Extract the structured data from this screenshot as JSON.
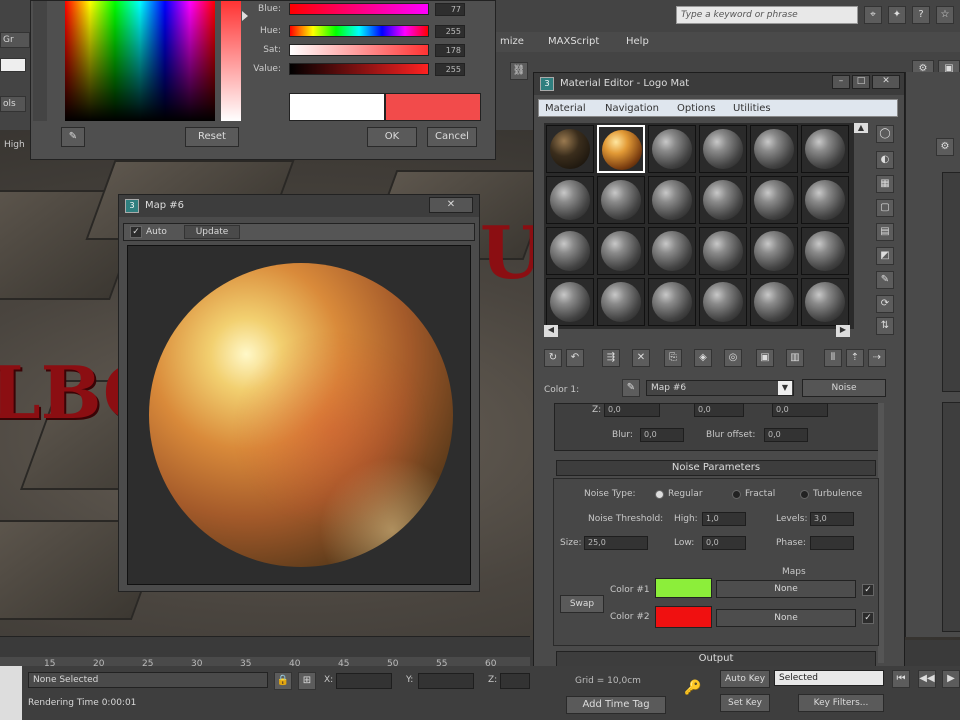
{
  "app": {
    "search_placeholder": "Type a keyword or phrase",
    "menu": [
      "mize",
      "MAXScript",
      "Help"
    ],
    "partial_left": [
      "Gr",
      "ols",
      "High"
    ]
  },
  "color_picker": {
    "sliders": [
      {
        "label": "Blue:",
        "value": "77"
      },
      {
        "label": "Hue:",
        "value": "255"
      },
      {
        "label": "Sat:",
        "value": "178"
      },
      {
        "label": "Value:",
        "value": "255"
      }
    ],
    "reset_label": "Reset",
    "ok_label": "OK",
    "cancel_label": "Cancel",
    "swatch_old": "#ffffff",
    "swatch_new": "#f24b4b"
  },
  "map_window": {
    "title": "Map #6",
    "auto_label": "Auto",
    "update_label": "Update",
    "close_glyph": "✕"
  },
  "material_editor": {
    "title": "Material Editor - Logo Mat",
    "menu": [
      "Material",
      "Navigation",
      "Options",
      "Utilities"
    ],
    "color_row": {
      "label": "Color 1:",
      "map_name": "Map #6",
      "type_button": "Noise"
    },
    "coords": {
      "values": [
        "0,0",
        "0,0",
        "0,0"
      ],
      "blur_label": "Blur:",
      "blur_value": "0,0",
      "blur_offset_label": "Blur offset:",
      "blur_offset_value": "0,0"
    },
    "noise_parameters": {
      "header": "Noise Parameters",
      "noise_type_label": "Noise Type:",
      "types": [
        "Regular",
        "Fractal",
        "Turbulence"
      ],
      "threshold_label": "Noise Threshold:",
      "high_label": "High:",
      "high_value": "1,0",
      "levels_label": "Levels:",
      "levels_value": "3,0",
      "low_label": "Low:",
      "low_value": "0,0",
      "size_label": "Size:",
      "size_value": "25,0",
      "phase_label": "Phase:",
      "maps_label": "Maps",
      "swap_label": "Swap",
      "color1_label": "Color #1",
      "color1": "#8cee3a",
      "color1_map": "None",
      "color2_label": "Color #2",
      "color2": "#f01010",
      "color2_map": "None"
    },
    "output_header": "Output"
  },
  "timeline": {
    "ticks": [
      "15",
      "20",
      "25",
      "30",
      "35",
      "40",
      "45",
      "50",
      "55",
      "60"
    ]
  },
  "status": {
    "none_selected": "None Selected",
    "rendering_time": "Rendering Time  0:00:01",
    "x_label": "X:",
    "y_label": "Y:",
    "z_label": "Z:",
    "grid": "Grid = 10,0cm",
    "add_time_tag": "Add Time Tag",
    "auto_key": "Auto Key",
    "selected": "Selected",
    "set_key": "Set Key",
    "key_filters": "Key Filters..."
  }
}
